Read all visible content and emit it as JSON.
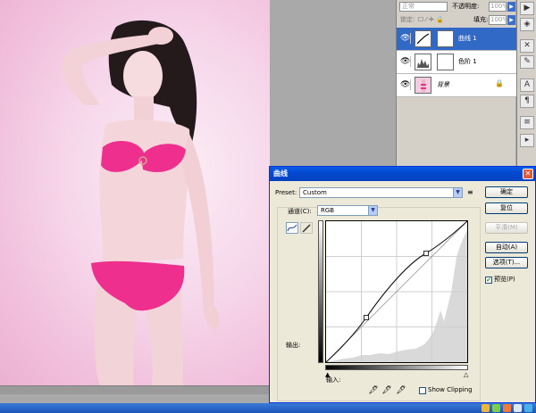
{
  "layers_panel": {
    "blend_mode": "正常",
    "opacity_label": "不透明度:",
    "opacity_value": "100%",
    "lock_label": "锁定:",
    "fill_label": "填充:",
    "fill_value": "100%",
    "layers": [
      {
        "name": "曲线 1",
        "selected": true
      },
      {
        "name": "色阶 1",
        "selected": false
      },
      {
        "name": "背景",
        "selected": false
      }
    ]
  },
  "tools": [
    "play-icon",
    "layers-icon",
    "tools-icon",
    "brush-icon",
    "text-icon",
    "paragraph-icon",
    "notes-icon",
    "arrow-icon"
  ],
  "dialog": {
    "title": "曲线",
    "close": "✕",
    "preset_label": "Preset:",
    "preset_value": "Custom",
    "channel_label": "通道(C):",
    "channel_value": "RGB",
    "output_label": "输出:",
    "input_label": "输入:",
    "show_clipping_label": "Show Clipping",
    "preview_label": "预览(P)",
    "preview_checked": true,
    "buttons": {
      "ok": "确定",
      "reset": "复位",
      "smooth": "平滑(M)",
      "auto": "自动(A)",
      "options": "选项(T)..."
    }
  },
  "colors": {
    "accent": "#3169c6",
    "dialog_bg": "#ece9d8",
    "bikini": "#ee2f8e"
  }
}
